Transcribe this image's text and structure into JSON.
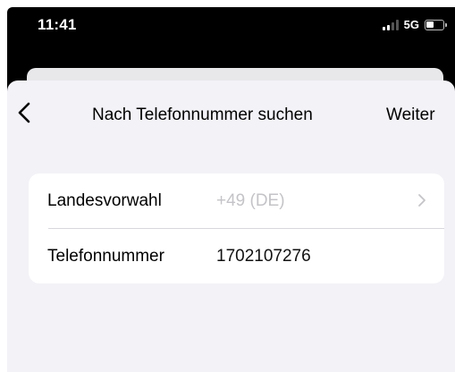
{
  "status_bar": {
    "time": "11:41",
    "network": "5G",
    "icons": [
      "signal-icon",
      "battery-icon"
    ]
  },
  "nav": {
    "back_icon": "chevron-left-icon",
    "title": "Nach Telefonnummer suchen",
    "next_label": "Weiter"
  },
  "form": {
    "country_code": {
      "label": "Landesvorwahl",
      "value": "+49 (DE)",
      "icon": "chevron-right-icon"
    },
    "phone": {
      "label": "Telefonnummer",
      "value": "1702107276"
    }
  },
  "colors": {
    "sheet_background": "#f2f2f7",
    "card_background": "#ffffff",
    "placeholder_text": "#c4c4c8"
  }
}
